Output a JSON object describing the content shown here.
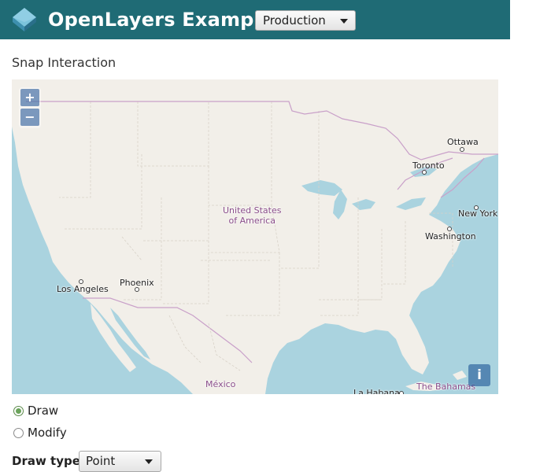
{
  "header": {
    "title": "OpenLayers Examples",
    "environment": "Production",
    "logo_icon": "openlayers-logo-icon",
    "bg_color": "#1f6b75"
  },
  "page": {
    "title": "Snap Interaction"
  },
  "map": {
    "zoom_in_label": "+",
    "zoom_out_label": "−",
    "attribution_label": "i",
    "labels": {
      "country_usa_line1": "United States",
      "country_usa_line2": "of America",
      "ottawa": "Ottawa",
      "toronto": "Toronto",
      "new_york": "New York",
      "washington": "Washington",
      "los_angeles": "Los Angeles",
      "phoenix": "Phoenix",
      "mexico": "México",
      "la_habana": "La Habana",
      "the_bahamas": "The Bahamas"
    },
    "colors": {
      "water": "#aad3df",
      "land": "#f2efe9",
      "border": "#c9a0c9"
    }
  },
  "controls": {
    "mode_options": [
      {
        "label": "Draw",
        "checked": true
      },
      {
        "label": "Modify",
        "checked": false
      }
    ],
    "draw_type_label": "Draw type",
    "draw_type_value": "Point"
  }
}
